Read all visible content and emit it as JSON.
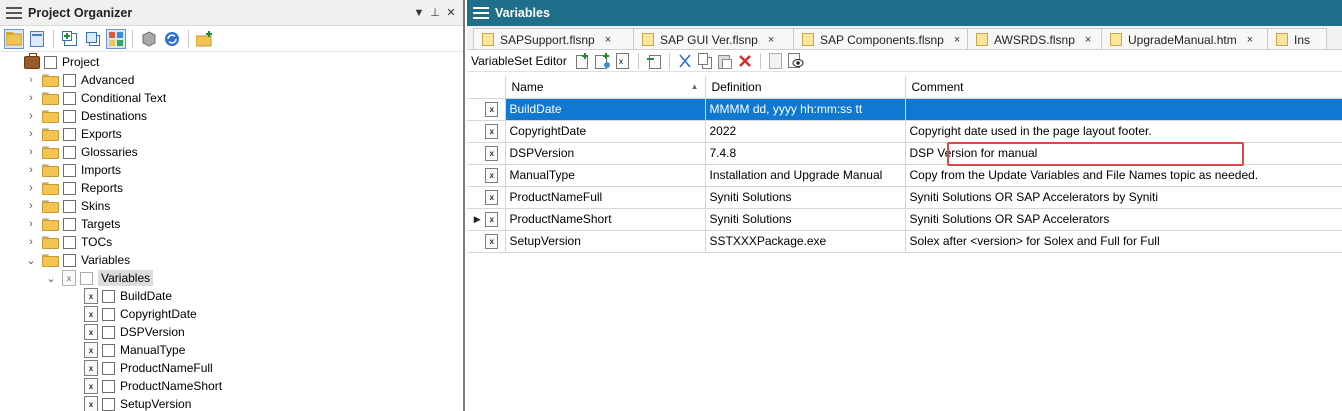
{
  "left_panel": {
    "title": "Project Organizer",
    "pin": "⊥",
    "close": "✕",
    "dropdown": "▼",
    "tree": [
      {
        "label": "Project",
        "kind": "project",
        "level": 0,
        "expander": ""
      },
      {
        "label": "Advanced",
        "kind": "folder",
        "level": 1,
        "expander": "›"
      },
      {
        "label": "Conditional Text",
        "kind": "folder",
        "level": 1,
        "expander": "›"
      },
      {
        "label": "Destinations",
        "kind": "folder",
        "level": 1,
        "expander": "›"
      },
      {
        "label": "Exports",
        "kind": "folder",
        "level": 1,
        "expander": "›"
      },
      {
        "label": "Glossaries",
        "kind": "folder",
        "level": 1,
        "expander": "›"
      },
      {
        "label": "Imports",
        "kind": "folder",
        "level": 1,
        "expander": "›"
      },
      {
        "label": "Reports",
        "kind": "folder",
        "level": 1,
        "expander": "›"
      },
      {
        "label": "Skins",
        "kind": "folder",
        "level": 1,
        "expander": "›"
      },
      {
        "label": "Targets",
        "kind": "folder",
        "level": 1,
        "expander": "›"
      },
      {
        "label": "TOCs",
        "kind": "folder",
        "level": 1,
        "expander": "›"
      },
      {
        "label": "Variables",
        "kind": "folder",
        "level": 1,
        "expander": "⌄"
      },
      {
        "label": "Variables",
        "kind": "varset",
        "level": 2,
        "expander": "⌄"
      },
      {
        "label": "BuildDate",
        "kind": "var",
        "level": 3,
        "expander": ""
      },
      {
        "label": "CopyrightDate",
        "kind": "var",
        "level": 3,
        "expander": ""
      },
      {
        "label": "DSPVersion",
        "kind": "var",
        "level": 3,
        "expander": ""
      },
      {
        "label": "ManualType",
        "kind": "var",
        "level": 3,
        "expander": ""
      },
      {
        "label": "ProductNameFull",
        "kind": "var",
        "level": 3,
        "expander": ""
      },
      {
        "label": "ProductNameShort",
        "kind": "var",
        "level": 3,
        "expander": ""
      },
      {
        "label": "SetupVersion",
        "kind": "var",
        "level": 3,
        "expander": ""
      }
    ]
  },
  "right_panel": {
    "title": "Variables",
    "tabs": [
      {
        "label": "SAPSupport.flsnp",
        "close": "×"
      },
      {
        "label": "SAP GUI Ver.flsnp",
        "close": "×"
      },
      {
        "label": "SAP Components.flsnp",
        "close": "×"
      },
      {
        "label": "AWSRDS.flsnp",
        "close": "×"
      },
      {
        "label": "UpgradeManual.htm",
        "close": "×"
      },
      {
        "label": "Ins",
        "close": ""
      }
    ],
    "editor_label": "VariableSet Editor",
    "columns": {
      "name": "Name",
      "definition": "Definition",
      "comment": "Comment"
    },
    "rows": [
      {
        "name": "BuildDate",
        "definition": "MMMM dd, yyyy hh:mm:ss tt",
        "comment": "",
        "marker": ""
      },
      {
        "name": "CopyrightDate",
        "definition": "2022",
        "comment": "Copyright date used in the page layout footer.",
        "marker": ""
      },
      {
        "name": "DSPVersion",
        "definition": "7.4.8",
        "comment": "DSP Version for manual",
        "marker": ""
      },
      {
        "name": "ManualType",
        "definition": "Installation and Upgrade Manual",
        "comment": "Copy from the Update Variables and File Names topic as needed.",
        "marker": ""
      },
      {
        "name": "ProductNameFull",
        "definition": "Syniti Solutions",
        "comment": "Syniti Solutions OR SAP Accelerators by Syniti",
        "marker": ""
      },
      {
        "name": "ProductNameShort",
        "definition": "Syniti Solutions",
        "comment": "Syniti Solutions OR SAP Accelerators",
        "marker": "▶"
      },
      {
        "name": "SetupVersion",
        "definition": "SSTXXXPackage.exe",
        "comment": "Solex after <version> for Solex and Full for Full",
        "marker": ""
      }
    ],
    "selected_row": 0,
    "highlighted_row": 2
  },
  "colors": {
    "selection": "#0f78d1",
    "title_bar": "#1f6f8b",
    "highlight_box": "#e0464a"
  }
}
